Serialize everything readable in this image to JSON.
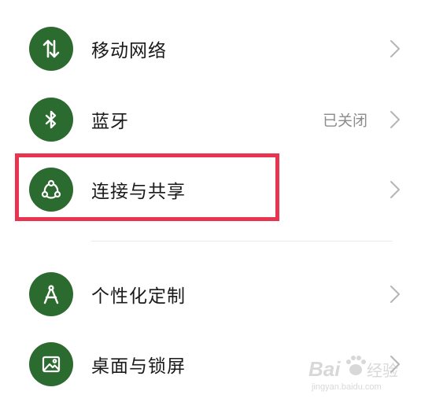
{
  "settings": {
    "items": [
      {
        "label": "移动网络",
        "status": "",
        "icon": "mobile-data-icon"
      },
      {
        "label": "蓝牙",
        "status": "已关闭",
        "icon": "bluetooth-icon"
      },
      {
        "label": "连接与共享",
        "status": "",
        "icon": "share-connection-icon"
      },
      {
        "label": "个性化定制",
        "status": "",
        "icon": "compass-icon"
      },
      {
        "label": "桌面与锁屏",
        "status": "",
        "icon": "image-icon"
      }
    ]
  },
  "watermark": {
    "brand": "Bai",
    "brand_suffix": "经验",
    "domain": "jingyan.baidu.com"
  },
  "colors": {
    "icon_background": "#2c6b2f",
    "highlight_border": "#e8344e",
    "status_text": "#8c8c8c"
  }
}
